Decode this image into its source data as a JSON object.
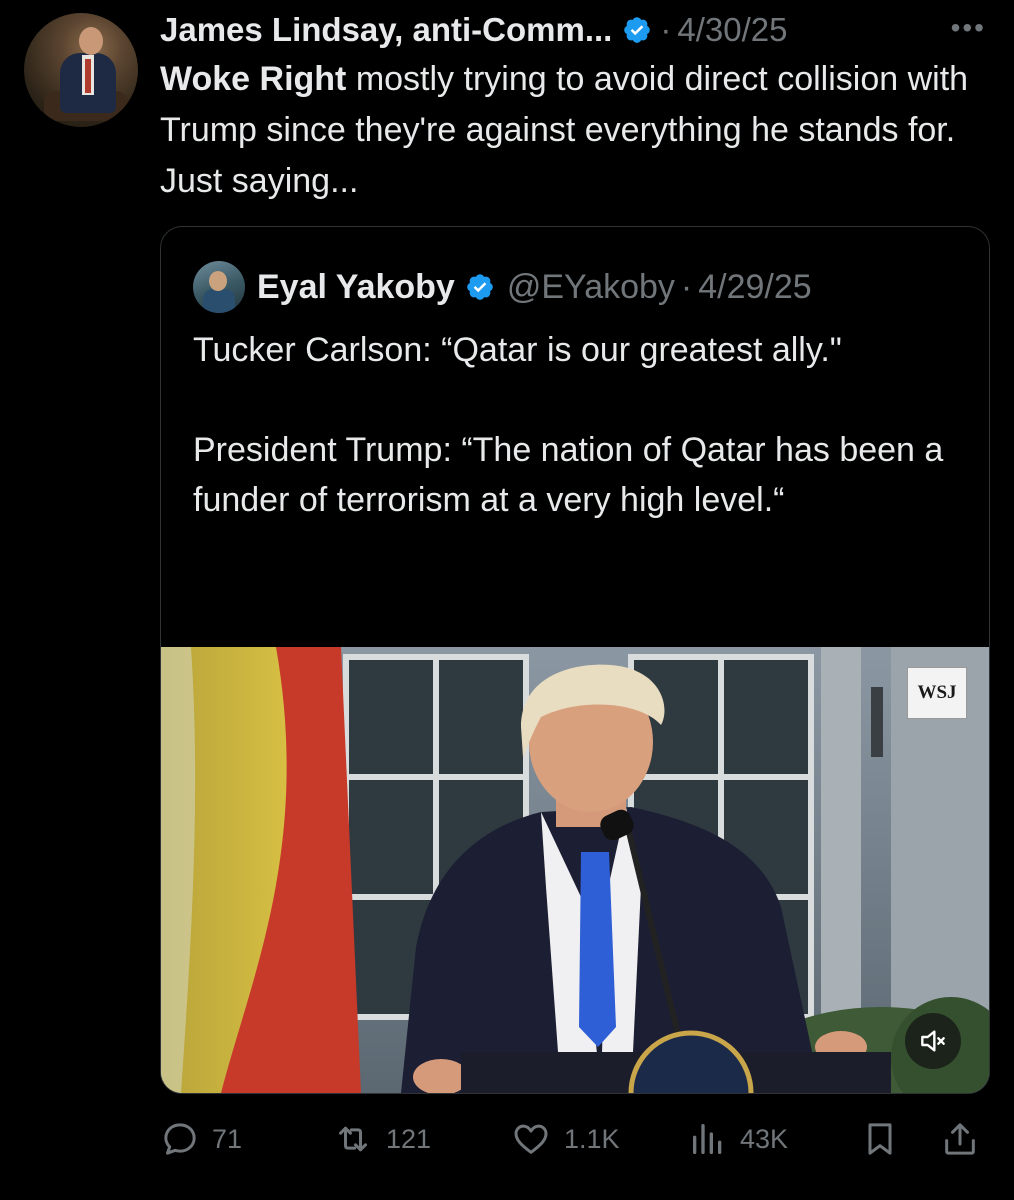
{
  "tweet": {
    "author_name": "James Lindsay, anti-Comm...",
    "date": "4/30/25",
    "separator": "·",
    "more_label": "•••",
    "text_bold": "Woke Right",
    "text_rest": " mostly trying to avoid direct collision with Trump since they're against everything he stands for. Just saying..."
  },
  "quoted": {
    "name": "Eyal Yakoby",
    "handle": "@EYakoby",
    "separator": "·",
    "date": "4/29/25",
    "paragraph1": "Tucker Carlson: “Qatar is our greatest ally.\"",
    "paragraph2": "President Trump: “The nation of Qatar has been a funder of terrorism at a very high level.“",
    "media": {
      "watermark": "WSJ",
      "mute_icon": "speaker-muted-icon"
    }
  },
  "actions": {
    "replies": "71",
    "reposts": "121",
    "likes": "1.1K",
    "views": "43K",
    "icons": [
      "reply-icon",
      "repost-icon",
      "like-icon",
      "views-icon",
      "bookmark-icon",
      "share-icon"
    ]
  },
  "colors": {
    "background": "#000000",
    "text": "#e7e9ea",
    "muted": "#71767b",
    "border": "#2f3336",
    "verified": "#1d9bf0"
  }
}
